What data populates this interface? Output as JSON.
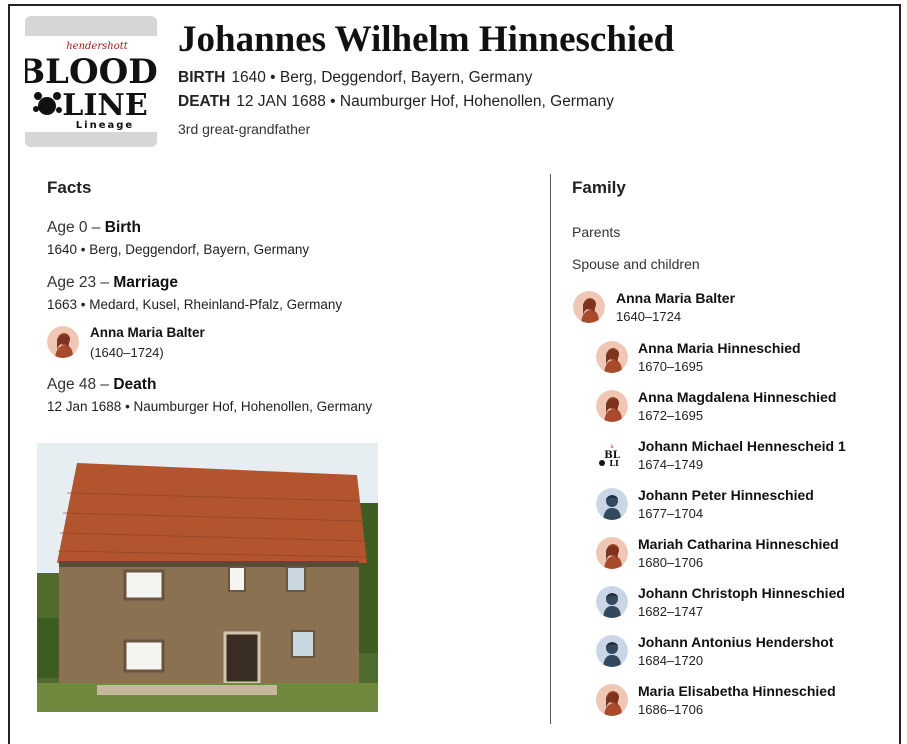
{
  "logo": {
    "top_text": "hendershott",
    "big_text_1": "BLOOD",
    "big_text_2": "LINE",
    "bottom_text": "Lineage"
  },
  "person": {
    "name": "Johannes Wilhelm Hinneschied",
    "birth_label": "BIRTH",
    "birth_value": "1640 • Berg, Deggendorf, Bayern, Germany",
    "death_label": "DEATH",
    "death_value": "12 JAN 1688 • Naumburger Hof, Hohenollen, Germany",
    "relationship": "3rd great-grandfather"
  },
  "facts": {
    "title": "Facts",
    "items": [
      {
        "age": "Age 0 – ",
        "event": "Birth",
        "detail": "1640 • Berg, Deggendorf, Bayern, Germany"
      },
      {
        "age": "Age 23 – ",
        "event": "Marriage",
        "detail": "1663 • Medard, Kusel, Rheinland-Pfalz, Germany"
      },
      {
        "age": "Age 48 – ",
        "event": "Death",
        "detail": "12 Jan 1688 • Naumburger Hof, Hohenollen, Germany"
      }
    ],
    "spouse": {
      "name": "Anna Maria Balter",
      "dates": "(1640–1724)"
    }
  },
  "family": {
    "title": "Family",
    "parents_label": "Parents",
    "spouse_children_label": "Spouse and children",
    "spouse": {
      "name": "Anna Maria Balter",
      "dates": "1640–1724",
      "avatar": "female"
    },
    "children": [
      {
        "name": "Anna Maria Hinneschied",
        "dates": "1670–1695",
        "avatar": "female"
      },
      {
        "name": "Anna Magdalena Hinneschied",
        "dates": "1672–1695",
        "avatar": "female"
      },
      {
        "name": "Johann Michael Hennescheid 1",
        "dates": "1674–1749",
        "avatar": "logo"
      },
      {
        "name": "Johann Peter Hinneschied",
        "dates": "1677–1704",
        "avatar": "male"
      },
      {
        "name": "Mariah Catharina Hinneschied",
        "dates": "1680–1706",
        "avatar": "female"
      },
      {
        "name": "Johann Christoph Hinneschied",
        "dates": "1682–1747",
        "avatar": "male"
      },
      {
        "name": "Johann Antonius Hendershot",
        "dates": "1684–1720",
        "avatar": "male"
      },
      {
        "name": "Maria Elisabetha Hinneschied",
        "dates": "1686–1706",
        "avatar": "female"
      }
    ]
  },
  "colors": {
    "female_avatar_bg": "#f0c7b5",
    "female_avatar_fg": "#a84a2c",
    "male_avatar_bg": "#c9d6e6",
    "male_avatar_fg": "#34495e",
    "logo_red": "#9b1b1b"
  }
}
